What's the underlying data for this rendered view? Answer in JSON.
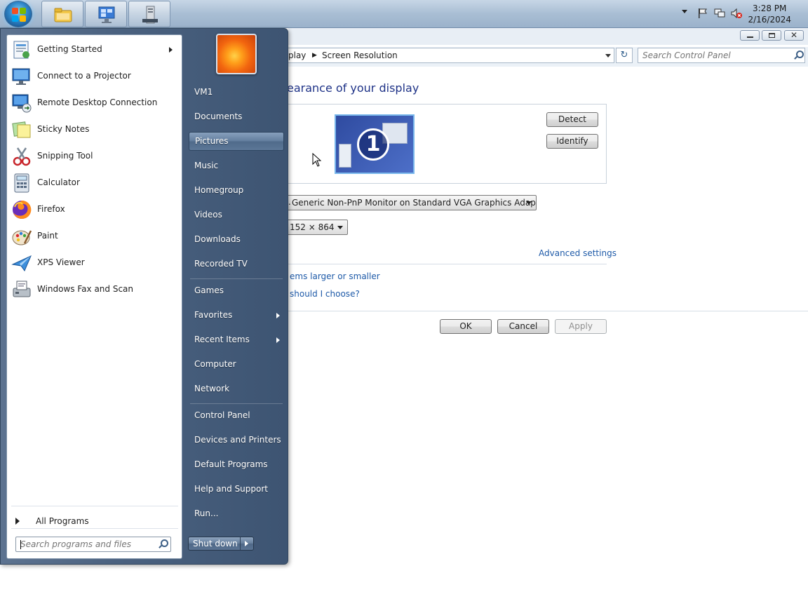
{
  "taskbar": {
    "start_button": "Start",
    "pinned": [
      "windows-explorer",
      "remote-desktop-connection",
      "server-manager"
    ],
    "clock_time": "3:28 PM",
    "clock_date": "2/16/2024"
  },
  "control_panel": {
    "breadcrumb": [
      "play",
      "Screen Resolution"
    ],
    "search_placeholder": "Search Control Panel",
    "heading": "earance of your display",
    "detect_label": "Detect",
    "identify_label": "Identify",
    "monitor_number": "1",
    "display_value": "Generic Non-PnP Monitor on Standard VGA Graphics Adapter",
    "resolution_value": "152 × 864",
    "advanced_link": "Advanced settings",
    "text_size_link": "ems larger or smaller",
    "choose_link": "should I choose?",
    "ok_label": "OK",
    "cancel_label": "Cancel",
    "apply_label": "Apply"
  },
  "start_menu": {
    "programs": [
      {
        "label": "Getting Started",
        "icon": "getting-started-icon",
        "has_submenu": true
      },
      {
        "label": "Connect to a Projector",
        "icon": "projector-icon",
        "has_submenu": false
      },
      {
        "label": "Remote Desktop Connection",
        "icon": "remote-desktop-icon",
        "has_submenu": false
      },
      {
        "label": "Sticky Notes",
        "icon": "sticky-notes-icon",
        "has_submenu": false
      },
      {
        "label": "Snipping Tool",
        "icon": "snipping-tool-icon",
        "has_submenu": false
      },
      {
        "label": "Calculator",
        "icon": "calculator-icon",
        "has_submenu": false
      },
      {
        "label": "Firefox",
        "icon": "firefox-icon",
        "has_submenu": false
      },
      {
        "label": "Paint",
        "icon": "paint-icon",
        "has_submenu": false
      },
      {
        "label": "XPS Viewer",
        "icon": "xps-viewer-icon",
        "has_submenu": false
      },
      {
        "label": "Windows Fax and Scan",
        "icon": "fax-scan-icon",
        "has_submenu": false
      }
    ],
    "all_programs": "All Programs",
    "search_placeholder": "Search programs and files",
    "right_items": [
      {
        "label": "VM1"
      },
      {
        "label": "Documents"
      },
      {
        "label": "Pictures",
        "selected": true
      },
      {
        "label": "Music"
      },
      {
        "label": "Homegroup"
      },
      {
        "label": "Videos"
      },
      {
        "label": "Downloads"
      },
      {
        "label": "Recorded TV"
      },
      {
        "label": "Games"
      },
      {
        "label": "Favorites",
        "has_submenu": true
      },
      {
        "label": "Recent Items",
        "has_submenu": true
      },
      {
        "label": "Computer"
      },
      {
        "label": "Network"
      },
      {
        "label": "Control Panel"
      },
      {
        "label": "Devices and Printers"
      },
      {
        "label": "Default Programs"
      },
      {
        "label": "Help and Support"
      },
      {
        "label": "Run..."
      }
    ],
    "shutdown_label": "Shut down"
  },
  "colors": {
    "link": "#1e5aa8",
    "heading": "#1e3287",
    "start_menu_bg": "#4b6280"
  }
}
